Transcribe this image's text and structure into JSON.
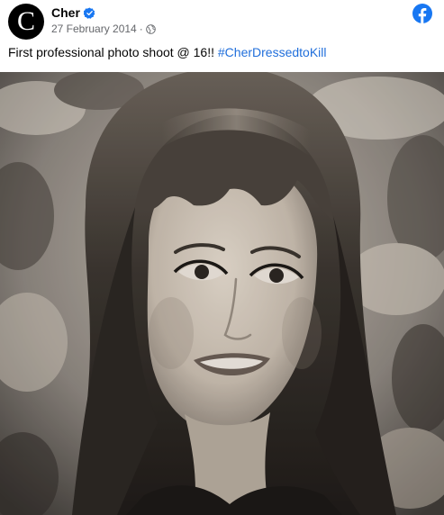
{
  "post": {
    "author": {
      "name": "Cher",
      "avatar_letter": "C",
      "verified": true
    },
    "meta": {
      "date": "27 February 2014",
      "separator": "·",
      "audience_icon": "globe-icon"
    },
    "platform_icon": "facebook-icon",
    "caption": {
      "text": "First professional photo shoot @ 16!!",
      "hashtag": "#CherDressedtoKill"
    },
    "photo": {
      "style": "vintage sepia-toned black and white portrait"
    },
    "colors": {
      "brand_blue": "#1877f2",
      "hashtag_blue": "#216fdb",
      "secondary_text": "#65676b",
      "primary_text": "#050505"
    }
  }
}
